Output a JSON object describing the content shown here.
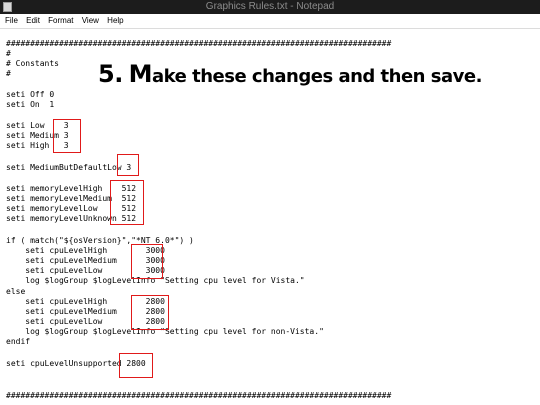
{
  "window": {
    "title": "Graphics Rules.txt - Notepad"
  },
  "menu": [
    "File",
    "Edit",
    "Format",
    "View",
    "Help"
  ],
  "annotation": {
    "num": "5.",
    "rest_big": "M",
    "rest": "ake these changes and then save."
  },
  "lines": {
    "hash1": "################################################################################",
    "hash_blank": "#",
    "constants": "# Constants",
    "hash_end": "#",
    "seti_off": "seti Off 0",
    "seti_on": "seti On  1",
    "low": "seti Low    3",
    "medium": "seti Medium 3",
    "high": "seti High   3",
    "mbdl": "seti MediumButDefaultLow 3",
    "mem_high": "seti memoryLevelHigh    512",
    "mem_medium": "seti memoryLevelMedium  512",
    "mem_low": "seti memoryLevelLow     512",
    "mem_unknown": "seti memoryLevelUnknown 512",
    "if_line": "if ( match(\"${osVersion}\",\"*NT 6.0*\") )",
    "cpu_high_1": "    seti cpuLevelHigh        3000",
    "cpu_medium_1": "    seti cpuLevelMedium      3000",
    "cpu_low_1": "    seti cpuLevelLow         3000",
    "log_vista": "    log $logGroup $logLevelInfo \"Setting cpu level for Vista.\"",
    "else_line": "else",
    "cpu_high_2": "    seti cpuLevelHigh        2800",
    "cpu_medium_2": "    seti cpuLevelMedium      2800",
    "cpu_low_2": "    seti cpuLevelLow         2800",
    "log_nonvista": "    log $logGroup $logLevelInfo \"Setting cpu level for non-Vista.\"",
    "endif_line": "endif",
    "cpu_unsupported": "seti cpuLevelUnsupported 2800",
    "hash2": "################################################################################"
  },
  "highlight_color": "#e01a1a"
}
